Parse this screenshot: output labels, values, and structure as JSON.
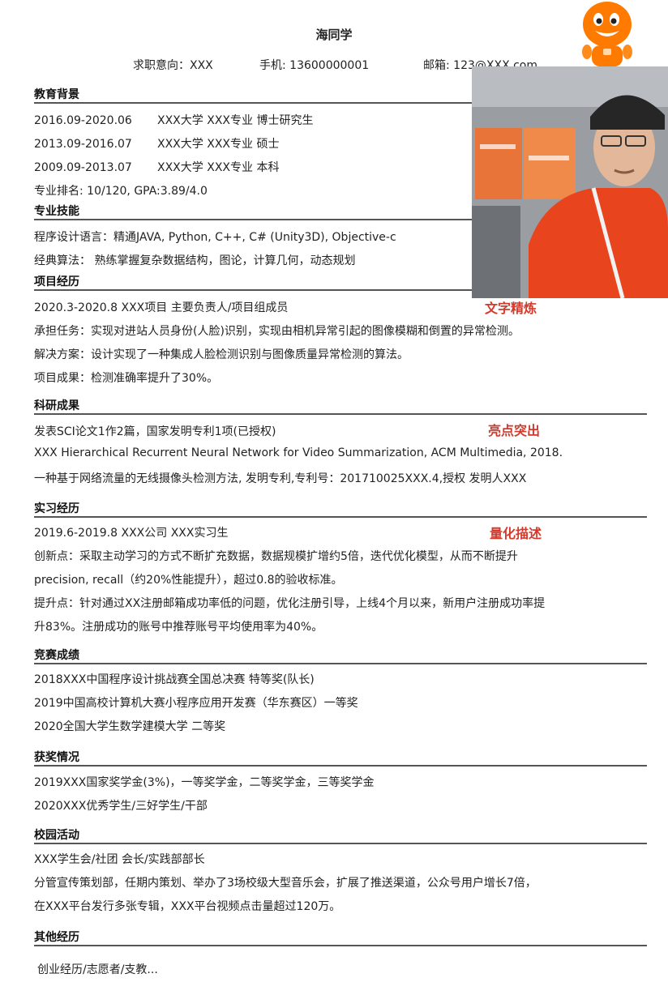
{
  "header": {
    "name": "海同学",
    "intent": "求职意向：XXX",
    "phone": "手机: 13600000001",
    "email": "邮箱: 123@XXX.com"
  },
  "education": {
    "title": "教育背景",
    "items": [
      {
        "date": "2016.09-2020.06",
        "text": "XXX大学  XXX专业  博士研究生"
      },
      {
        "date": "2013.09-2016.07",
        "text": "XXX大学  XXX专业  硕士"
      },
      {
        "date": "2009.09-2013.07",
        "text": "XXX大学  XXX专业  本科"
      }
    ],
    "rank": "专业排名: 10/120, GPA:3.89/4.0"
  },
  "skills": {
    "title": "专业技能",
    "lines": [
      "程序设计语言：精通JAVA, Python, C++, C# (Unity3D), Objective-c",
      "经典算法：  熟练掌握复杂数据结构，图论，计算几何，动态规划"
    ]
  },
  "projects": {
    "title": "项目经历",
    "lines": [
      "2020.3-2020.8 XXX项目    主要负责人/项目组成员",
      "承担任务：实现对进站人员身份(人脸)识别，实现由相机异常引起的图像模糊和倒置的异常检测。",
      "解决方案：设计实现了一种集成人脸检测识别与图像质量异常检测的算法。",
      "项目成果：检测准确率提升了30%。"
    ],
    "annotation": "文字精炼"
  },
  "research": {
    "title": "科研成果",
    "lines": [
      "发表SCI论文1作2篇，国家发明专利1项(已授权)",
      "XXX Hierarchical Recurrent Neural Network for Video Summarization, ACM Multimedia, 2018.",
      "一种基于网络流量的无线摄像头检测方法, 发明专利,专利号：201710025XXX.4,授权  发明人XXX"
    ],
    "annotation": "亮点突出"
  },
  "internship": {
    "title": "实习经历",
    "lines": [
      "2019.6-2019.8 XXX公司  XXX实习生",
      "创新点：采取主动学习的方式不断扩充数据，数据规模扩增约5倍，迭代优化模型，从而不断提升",
      "precision, recall（约20%性能提升），超过0.8的验收标准。",
      "提升点：针对通过XX注册邮箱成功率低的问题，优化注册引导，上线4个月以来，新用户注册成功率提",
      "升83%。注册成功的账号中推荐账号平均使用率为40%。"
    ],
    "annotation": "量化描述"
  },
  "competitions": {
    "title": "竞赛成绩",
    "lines": [
      "2018XXX中国程序设计挑战赛全国总决赛    特等奖(队长)",
      "2019中国高校计算机大赛小程序应用开发赛（华东赛区）一等奖",
      "2020全国大学生数学建模大学  二等奖"
    ]
  },
  "awards": {
    "title": "获奖情况",
    "lines": [
      "2019XXX国家奖学金(3%)，一等奖学金，二等奖学金，三等奖学金",
      "2020XXX优秀学生/三好学生/干部"
    ]
  },
  "campus": {
    "title": "校园活动",
    "lines": [
      "XXX学生会/社团  会长/实践部部长",
      "分管宣传策划部，任期内策划、举办了3场校级大型音乐会，扩展了推送渠道，公众号用户增长7倍，",
      "在XXX平台发行多张专辑，XXX平台视频点击量超过120万。"
    ]
  },
  "other": {
    "title": "其他经历",
    "lines": [
      "创业经历/志愿者/支教..."
    ]
  },
  "colors": {
    "annotation": "#d33a2c",
    "mascot": "#ff7a00",
    "jacket": "#e8451f"
  }
}
